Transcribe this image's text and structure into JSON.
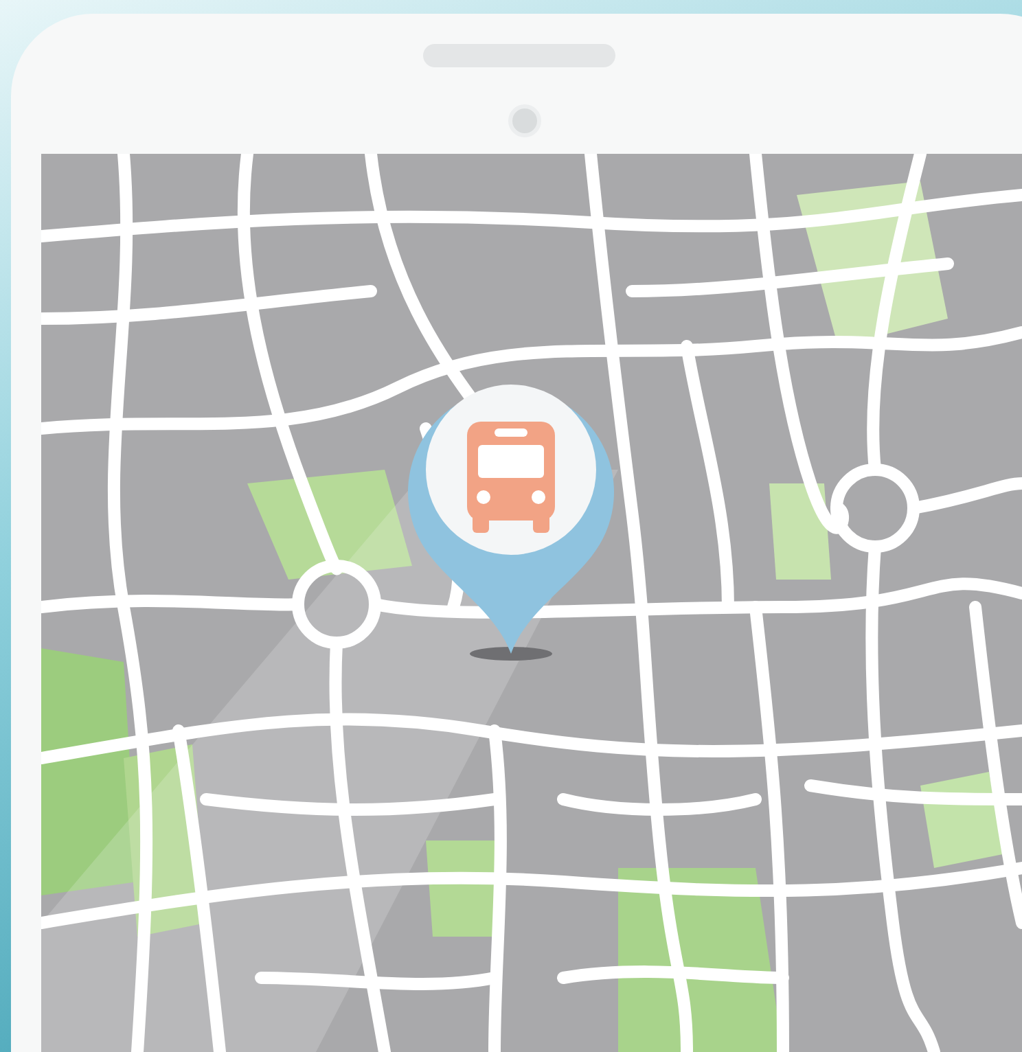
{
  "map": {
    "markers": [
      {
        "kind": "bus"
      }
    ]
  }
}
